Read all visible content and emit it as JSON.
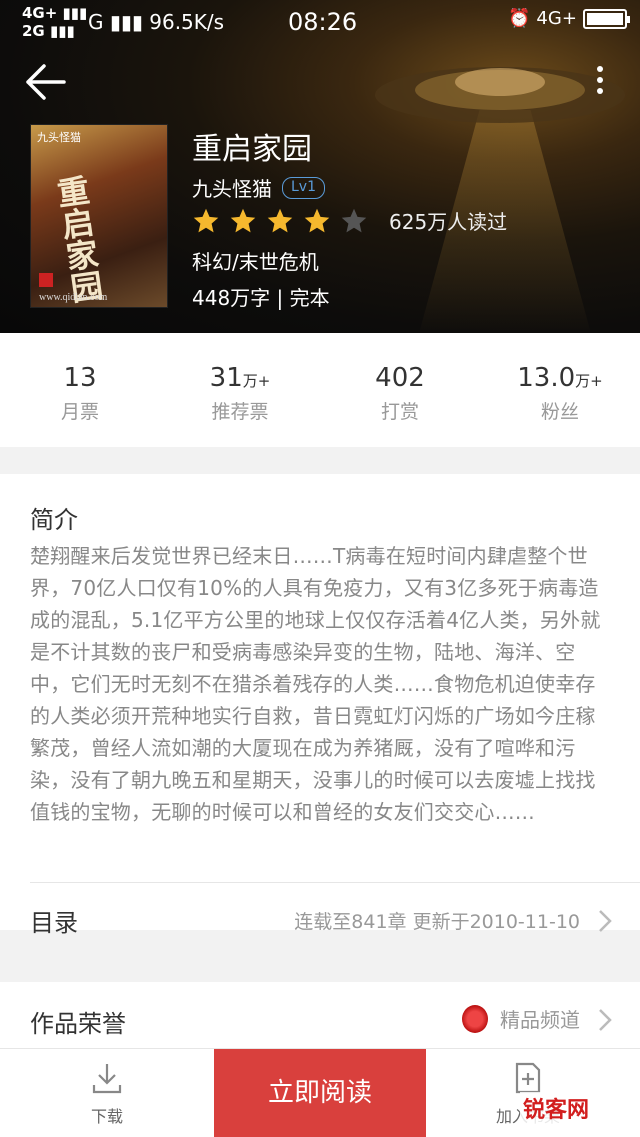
{
  "status_bar": {
    "net_top": "4G+",
    "net_bottom": "2G",
    "carrier": "G",
    "speed": "96.5K/s",
    "time": "08:26",
    "right_net": "4G+",
    "battery_level": 1.0
  },
  "book": {
    "title": "重启家园",
    "author": "九头怪猫",
    "author_level": "Lv1",
    "rating_stars": 4,
    "rating_max": 5,
    "readers": "625万人读过",
    "genre": "科幻/末世危机",
    "words": "448万字",
    "status": "| 完本",
    "cover_publisher": "九头怪猫",
    "cover_title": "重启家园",
    "cover_site": "www.qidian.com"
  },
  "stats": [
    {
      "num": "13",
      "unit": "",
      "label": "月票"
    },
    {
      "num": "31",
      "unit": "万+",
      "label": "推荐票"
    },
    {
      "num": "402",
      "unit": "",
      "label": "打赏"
    },
    {
      "num": "13.0",
      "unit": "万+",
      "label": "粉丝"
    }
  ],
  "intro": {
    "heading": "简介",
    "text": "楚翔醒来后发觉世界已经末日……T病毒在短时间内肆虐整个世界，70亿人口仅有10%的人具有免疫力，又有3亿多死于病毒造成的混乱，5.1亿平方公里的地球上仅仅存活着4亿人类，另外就是不计其数的丧尸和受病毒感染异变的生物，陆地、海洋、空中，它们无时无刻不在猎杀着残存的人类……食物危机迫使幸存的人类必须开荒种地实行自救，昔日霓虹灯闪烁的广场如今庄稼繁茂，曾经人流如潮的大厦现在成为养猪厩，没有了喧哗和污染，没有了朝九晚五和星期天，没事儿的时候可以去废墟上找找值钱的宝物，无聊的时候可以和曾经的女友们交交心……"
  },
  "toc": {
    "label": "目录",
    "info": "连载至841章  更新于2010-11-10"
  },
  "honor": {
    "label": "作品荣誉",
    "badge": "精品频道"
  },
  "bottom_bar": {
    "download_label": "下载",
    "read_label": "立即阅读",
    "add_label": "加入书架"
  },
  "watermark": "锐客网",
  "colors": {
    "accent": "#d9403d",
    "star": "#f5b82e",
    "level_badge": "#5a9bd8"
  }
}
